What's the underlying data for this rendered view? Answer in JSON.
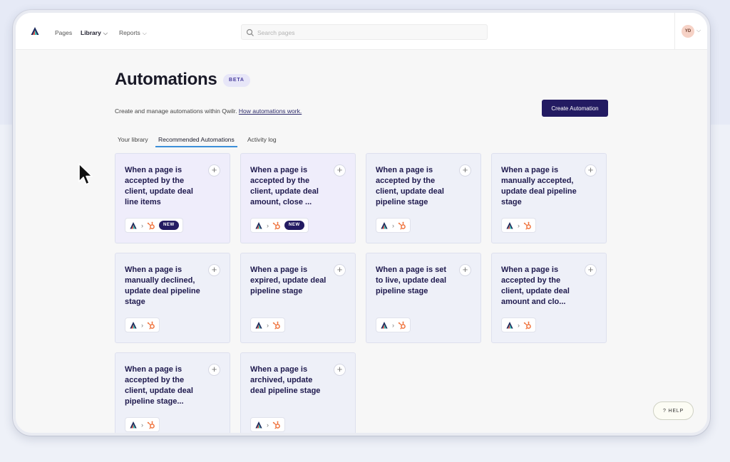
{
  "header": {
    "nav": [
      {
        "label": "Pages"
      },
      {
        "label": "Library"
      },
      {
        "label": "Reports"
      }
    ],
    "search": {
      "placeholder": "Search pages",
      "value": ""
    },
    "avatar_initials": "YD"
  },
  "page": {
    "title": "Automations",
    "badge": "BETA",
    "subtitle": "Create and manage automations within Qwilr.",
    "subtitle_link": "How automations work.",
    "create_button": "Create Automation"
  },
  "tabs": [
    {
      "label": "Your library"
    },
    {
      "label": "Recommended Automations"
    },
    {
      "label": "Activity log"
    }
  ],
  "active_tab": "Recommended Automations",
  "cards": [
    {
      "title": "When a page is accepted by the client, update deal line items",
      "badge": "NEW"
    },
    {
      "title": "When a page is accepted by the client, update deal amount, close ...",
      "badge": "NEW"
    },
    {
      "title": "When a page is accepted by the client, update deal pipeline stage"
    },
    {
      "title": "When a page is manually accepted, update deal pipeline stage"
    },
    {
      "title": "When a page is manually declined, update deal pipeline stage"
    },
    {
      "title": "When a page is expired, update deal pipeline stage"
    },
    {
      "title": "When a page is set to live, update deal pipeline stage"
    },
    {
      "title": "When a page is accepted by the client, update deal amount and clo..."
    },
    {
      "title": "When a page is accepted by the client, update deal pipeline stage..."
    },
    {
      "title": "When a page is archived, update deal pipeline stage"
    }
  ],
  "help_button": "? HELP",
  "colors": {
    "primary": "#231b62",
    "tab_underline": "#3b8fd9",
    "hubspot": "#f0743e",
    "card_background": "#eef0f8"
  },
  "icons": [
    "qwilr-logo-icon",
    "chevron-down-icon",
    "search-icon",
    "plus-icon",
    "hubspot-icon",
    "mouse-cursor-icon"
  ]
}
